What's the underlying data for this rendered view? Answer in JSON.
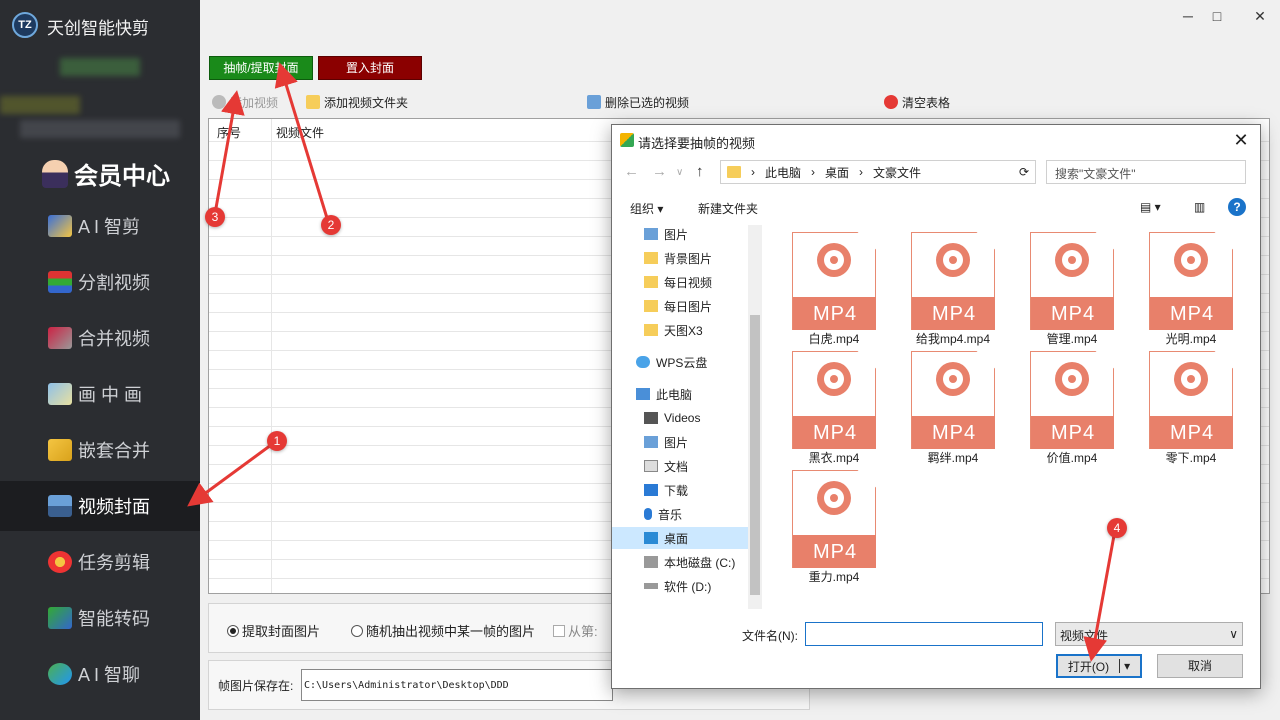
{
  "app": {
    "logo_text": "TZ",
    "title": "天创智能快剪"
  },
  "sidebar": {
    "vip_label": "会员中心",
    "items": [
      {
        "label": "A I 智剪",
        "icon": "ai-wand-icon"
      },
      {
        "label": "分割视频",
        "icon": "split-video-icon"
      },
      {
        "label": "合并视频",
        "icon": "merge-video-icon"
      },
      {
        "label": "画 中 画",
        "icon": "picture-in-picture-icon"
      },
      {
        "label": "嵌套合并",
        "icon": "nested-merge-icon"
      },
      {
        "label": "视频封面",
        "icon": "video-cover-icon",
        "active": true
      },
      {
        "label": "任务剪辑",
        "icon": "task-edit-icon"
      },
      {
        "label": "智能转码",
        "icon": "transcode-icon"
      },
      {
        "label": "A I 智聊",
        "icon": "ai-chat-icon"
      }
    ]
  },
  "window_controls": {
    "minimize": "─",
    "maximize": "□",
    "close": "✕"
  },
  "top_buttons": {
    "extract": "抽帧/提取封面",
    "insert": "置入封面"
  },
  "toolbar": {
    "add_video": "添加视频",
    "add_folder": "添加视频文件夹",
    "delete_selected": "删除已选的视频",
    "clear_table": "清空表格"
  },
  "grid": {
    "col_index": "序号",
    "col_file": "视频文件"
  },
  "options": {
    "opt_extract_cover": "提取封面图片",
    "opt_random_frame": "随机抽出视频中某一帧的图片",
    "opt_from": "从第:"
  },
  "save": {
    "label": "帧图片保存在:",
    "path": "C:\\Users\\Administrator\\Desktop\\DDD"
  },
  "dialog": {
    "title": "请选择要抽帧的视频",
    "close": "✕",
    "breadcrumb": [
      "此电脑",
      "桌面",
      "文豪文件"
    ],
    "search_placeholder": "搜索\"文豪文件\"",
    "organize": "组织 ▾",
    "new_folder": "新建文件夹",
    "help": "?",
    "tree": [
      {
        "label": "图片",
        "icon": "pictures-icon"
      },
      {
        "label": "背景图片",
        "icon": "folder-icon"
      },
      {
        "label": "每日视频",
        "icon": "folder-icon"
      },
      {
        "label": "每日图片",
        "icon": "folder-icon"
      },
      {
        "label": "天图X3",
        "icon": "folder-icon"
      },
      {
        "label": "WPS云盘",
        "icon": "cloud-icon"
      },
      {
        "label": "此电脑",
        "icon": "computer-icon"
      },
      {
        "label": "Videos",
        "icon": "videos-icon"
      },
      {
        "label": "图片",
        "icon": "pictures-icon"
      },
      {
        "label": "文档",
        "icon": "documents-icon"
      },
      {
        "label": "下载",
        "icon": "download-icon"
      },
      {
        "label": "音乐",
        "icon": "music-icon"
      },
      {
        "label": "桌面",
        "icon": "desktop-icon",
        "selected": true
      },
      {
        "label": "本地磁盘 (C:)",
        "icon": "drive-icon"
      },
      {
        "label": "软件 (D:)",
        "icon": "drive-icon"
      }
    ],
    "files": [
      {
        "name": "白虎.mp4"
      },
      {
        "name": "给我mp4.mp4"
      },
      {
        "name": "管理.mp4"
      },
      {
        "name": "光明.mp4"
      },
      {
        "name": "黑衣.mp4"
      },
      {
        "name": "羁绊.mp4"
      },
      {
        "name": "价值.mp4"
      },
      {
        "name": "零下.mp4"
      },
      {
        "name": "重力.mp4"
      }
    ],
    "file_badge": "MP4",
    "filename_label": "文件名(N):",
    "filename_value": "",
    "filetype": "视频文件",
    "open_label": "打开(O)",
    "cancel_label": "取消"
  },
  "annotations": [
    "1",
    "2",
    "3",
    "4"
  ],
  "colors": {
    "sidebar_bg": "#2b2d31",
    "extract_btn": "#1a8a1a",
    "insert_btn": "#8b0000",
    "annotation": "#e53935",
    "file_icon": "#e8806a"
  }
}
